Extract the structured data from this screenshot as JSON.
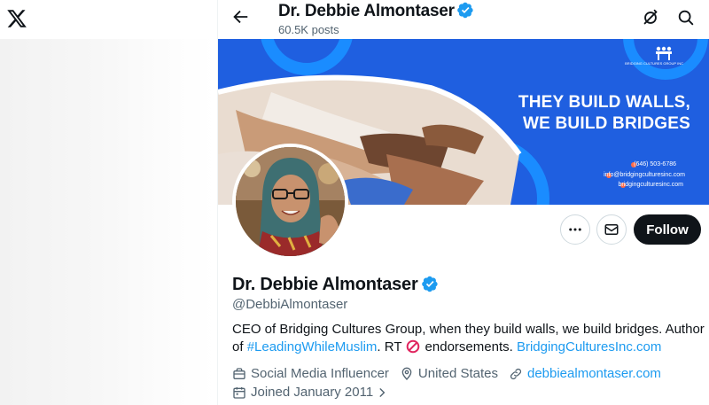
{
  "app": {
    "logo": "x-logo"
  },
  "header": {
    "name": "Dr. Debbie Almontaser",
    "posts": "60.5K posts",
    "icons": [
      "back-arrow-icon",
      "verified-badge-icon",
      "grok-icon",
      "search-icon"
    ]
  },
  "banner": {
    "headline_1": "THEY BUILD WALLS,",
    "headline_2": "WE BUILD BRIDGES",
    "phone": "(646) 503-6786",
    "email": "info@bridgingculturesinc.com",
    "website": "bridgingculturesinc.com",
    "logo_text": "BRIDGING CULTURES GROUP INC",
    "colors": {
      "background": "#1f5fe0",
      "accent_rings": "#1a8cff"
    }
  },
  "actions": {
    "more_icon": "more-dots-icon",
    "message_icon": "envelope-icon",
    "follow_label": "Follow"
  },
  "profile": {
    "name": "Dr. Debbie Almontaser",
    "handle": "@DebbiAlmontaser",
    "bio_text_1": "CEO of Bridging Cultures Group, when they build walls, we build bridges. Author of ",
    "bio_hashtag": "#LeadingWhileMuslim",
    "bio_text_2": ". RT ",
    "bio_text_3": " endorsements. ",
    "bio_link": "BridgingCulturesInc.com",
    "category": "Social Media Influencer",
    "location": "United States",
    "website": "debbiealmontaser.com",
    "joined": "Joined January 2011"
  },
  "colors": {
    "link": "#1d9bf0",
    "text": "#0f1419",
    "muted": "#536471",
    "follow_bg": "#0f1419"
  }
}
